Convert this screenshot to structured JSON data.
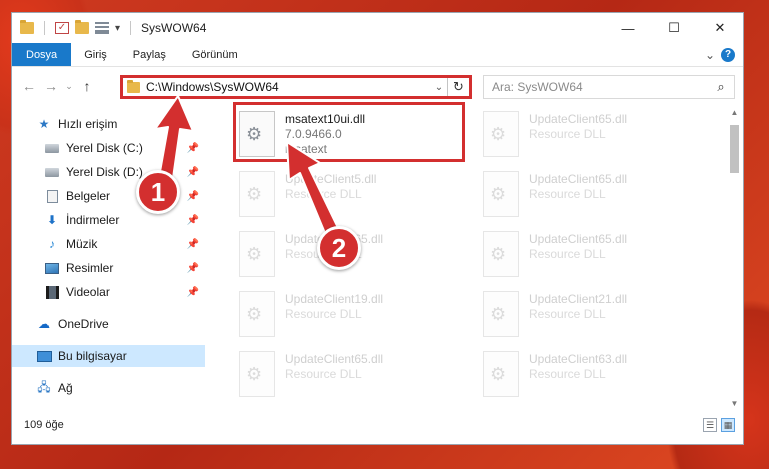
{
  "window": {
    "title": "SysWOW64",
    "controls": {
      "minimize": "—",
      "maximize": "☐",
      "close": "✕"
    }
  },
  "quick_access_toolbar": {
    "dropdown": "▾"
  },
  "ribbon": {
    "tabs": [
      {
        "label": "Dosya"
      },
      {
        "label": "Giriş"
      },
      {
        "label": "Paylaş"
      },
      {
        "label": "Görünüm"
      }
    ],
    "expand": "⌄",
    "help": "?"
  },
  "navigation": {
    "back": "←",
    "forward": "→",
    "recent": "⌄",
    "up": "↑",
    "address_path": "C:\\Windows\\SysWOW64",
    "address_dropdown": "⌄",
    "refresh": "↻",
    "search_placeholder": "Ara: SysWOW64",
    "search_icon": "⌕"
  },
  "sidebar": {
    "items": [
      {
        "label": "Hızlı erişim",
        "icon": "star-icon"
      },
      {
        "label": "Yerel Disk (C:)",
        "icon": "drive-icon",
        "pinned": true
      },
      {
        "label": "Yerel Disk (D:)",
        "icon": "drive-icon",
        "pinned": true
      },
      {
        "label": "Belgeler",
        "icon": "document-icon",
        "pinned": true
      },
      {
        "label": "İndirmeler",
        "icon": "download-icon",
        "pinned": true
      },
      {
        "label": "Müzik",
        "icon": "music-icon",
        "pinned": true
      },
      {
        "label": "Resimler",
        "icon": "pictures-icon",
        "pinned": true
      },
      {
        "label": "Videolar",
        "icon": "videos-icon",
        "pinned": true
      },
      {
        "label": "OneDrive",
        "icon": "cloud-icon"
      },
      {
        "label": "Bu bilgisayar",
        "icon": "computer-icon",
        "selected": true
      },
      {
        "label": "Ağ",
        "icon": "network-icon"
      }
    ],
    "pin_glyph": "📌"
  },
  "files": [
    {
      "name": "msatext10ui.dll",
      "line2": "7.0.9466.0",
      "line3": "msatext",
      "highlighted": true
    },
    {
      "name": "UpdateClient65.dll",
      "line2": "Resource DLL"
    },
    {
      "name": "UpdateClient5.dll",
      "line2": "Resource DLL"
    },
    {
      "name": "UpdateClient65.dll",
      "line2": "Resource DLL"
    },
    {
      "name": "UpdateClient65.dll",
      "line2": "Resource DLL"
    },
    {
      "name": "UpdateClient65.dll",
      "line2": "Resource DLL"
    },
    {
      "name": "UpdateClient19.dll",
      "line2": "Resource DLL"
    },
    {
      "name": "UpdateClient21.dll",
      "line2": "Resource DLL"
    },
    {
      "name": "UpdateClient65.dll",
      "line2": "Resource DLL"
    },
    {
      "name": "UpdateClient63.dll",
      "line2": "Resource DLL"
    }
  ],
  "status": {
    "item_count": "109 öğe"
  },
  "annotations": [
    {
      "label": "1"
    },
    {
      "label": "2"
    }
  ],
  "colors": {
    "accent": "#1979ca",
    "annotation": "#d32f2f",
    "selection": "#cde8ff"
  }
}
